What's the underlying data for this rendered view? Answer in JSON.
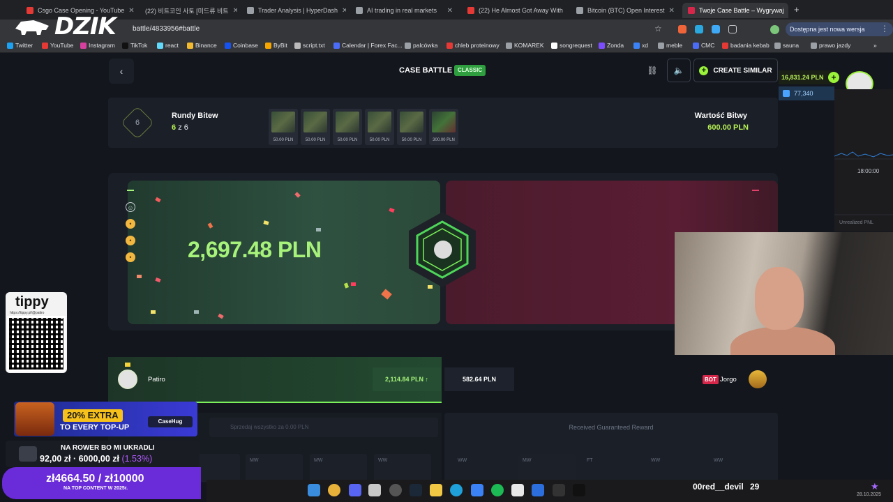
{
  "browser": {
    "tabs": [
      {
        "title": "Csgo Case Opening - YouTube"
      },
      {
        "title": "(22) 비트코인 사토 [미드류 비트"
      },
      {
        "title": "Trader Analysis | HyperDash"
      },
      {
        "title": "AI trading in real markets"
      },
      {
        "title": "(22) He Almost Got Away With"
      },
      {
        "title": "Bitcoin (BTC) Open Interest"
      },
      {
        "title": "Twoje Case Battle – Wygrywaj"
      }
    ],
    "url": "battle/4833956#battle",
    "update_notice": "Dostępna jest nowa wersja Chrome",
    "bookmarks": [
      "Twitter",
      "YouTube",
      "Instagram",
      "TikTok",
      "react",
      "Binance",
      "Coinbase",
      "ByBit",
      "script.txt",
      "Calendar | Forex Fac...",
      "palcówka",
      "chleb proteinowy",
      "KOMAREK",
      "songrequest",
      "Zonda",
      "xd",
      "meble",
      "CMC",
      "badania kebab",
      "sauna",
      "prawo jazdy"
    ]
  },
  "logo": {
    "text": "DZIK"
  },
  "header": {
    "title": "CASE BATTLE",
    "mode": "CLASSIC",
    "create_label": "CREATE SIMILAR"
  },
  "account": {
    "balance": "16,831.24 PLN",
    "gems": "77,340"
  },
  "rounds": {
    "total": "6",
    "label": "Rundy Bitew",
    "current": "6",
    "of_text": "z 6",
    "cases": [
      "50.00 PLN",
      "50.00 PLN",
      "50.00 PLN",
      "50.00 PLN",
      "50.00 PLN",
      "300.00 PLN"
    ],
    "value_label": "Wartość Bitwy",
    "value": "600.00 PLN"
  },
  "arena": {
    "win_amount": "2,697.48 PLN"
  },
  "players": {
    "winner": {
      "name": "Patiro",
      "amount": "2,114.84 PLN ↑"
    },
    "loser": {
      "badge": "BOT",
      "name": "Jorgo",
      "amount": "582.64 PLN"
    }
  },
  "lower": {
    "sell_all": "Sprzedaj wszystko za 0.00 PLN",
    "guaranteed": "Received Guaranteed Reward",
    "left_cards": [
      "WW",
      "MW",
      "MW",
      "WW"
    ],
    "right_cards": [
      "WW",
      "MW",
      "FT",
      "WW",
      "WW"
    ]
  },
  "trading": {
    "time": "18:00:00",
    "pnl_label": "Unrealized PNL"
  },
  "stream": {
    "tippy_logo": "tippy",
    "tippy_url": "https://tippy.pl/@patiro",
    "promo_line1": "20% EXTRA",
    "promo_line2": "TO EVERY TOP-UP",
    "promo_brand": "CaseHug",
    "goal_title": "NA ROWER BO MI UKRADLI",
    "goal_current": "92,00 zł",
    "goal_target": "6000,00 zł",
    "goal_pct": "(1.53%)",
    "donate_amount": "zł4664.50 / zł10000",
    "donate_sub": "NA TOP CONTENT W 2025r.",
    "sub_name": "00red__devil",
    "sub_count": "29",
    "date": "28.10.2025"
  }
}
